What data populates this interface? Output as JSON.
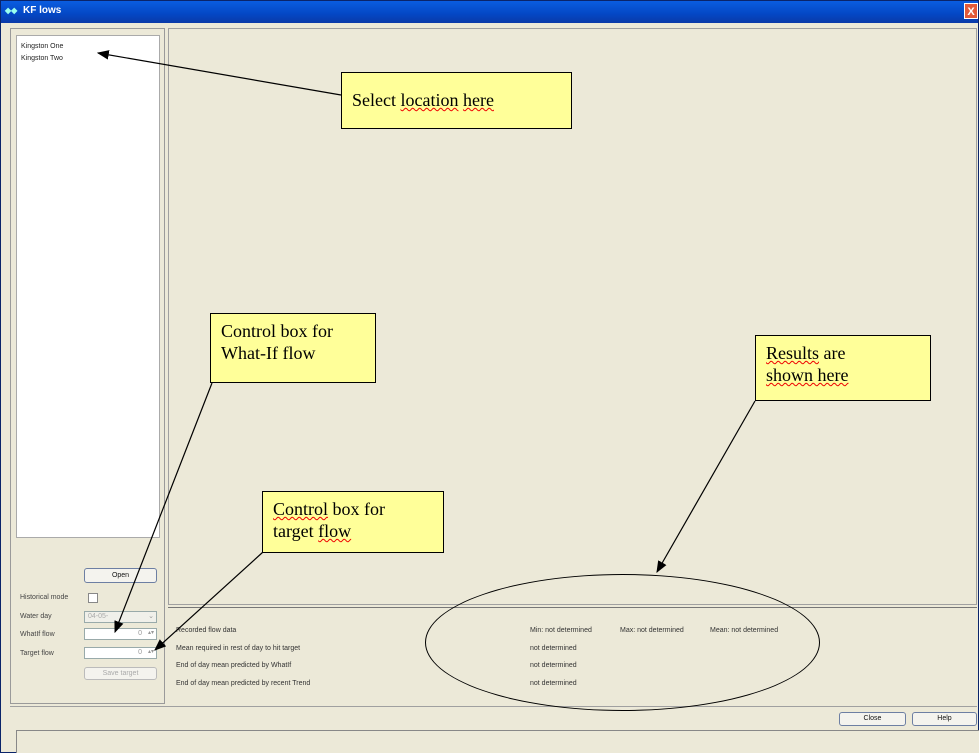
{
  "window": {
    "title": "KF lows",
    "icon": "app-icon",
    "close_label": "X"
  },
  "locations": {
    "items": [
      "Kingston One",
      "Kingston Two"
    ]
  },
  "controls": {
    "open_label": "Open",
    "historical_mode_label": "Historical mode",
    "water_day_label": "Water day",
    "water_day_value": "04-05-",
    "whatif_flow_label": "WhatIf flow",
    "whatif_flow_value": "0",
    "target_flow_label": "Target flow",
    "target_flow_value": "0",
    "save_target_label": "Save target"
  },
  "results": {
    "rows": [
      {
        "label": "Recorded flow data",
        "value": "Min: not determined",
        "max": "Max: not determined",
        "mean": "Mean: not determined"
      },
      {
        "label": "Mean required in rest of day to hit target",
        "value": "not determined"
      },
      {
        "label": "End of day mean predicted by WhatIf",
        "value": "not determined"
      },
      {
        "label": "End of day mean predicted by recent Trend",
        "value": "not determined"
      }
    ]
  },
  "footer": {
    "close_label": "Close",
    "help_label": "Help"
  },
  "annotations": {
    "select_location_a": "Select ",
    "select_location_b": "location",
    "select_location_c": " ",
    "select_location_d": "here",
    "control_whatif_line1": "Control box for",
    "control_whatif_line2": "What-If flow",
    "control_target_a": "Control",
    "control_target_b": " box for",
    "control_target_c": "target ",
    "control_target_d": "flow",
    "results_a": "Results",
    "results_b": " are",
    "results_c": "shown here"
  },
  "colors": {
    "title_bar": "#0447c4",
    "panel": "#ece9d8",
    "note": "#ffff99"
  }
}
